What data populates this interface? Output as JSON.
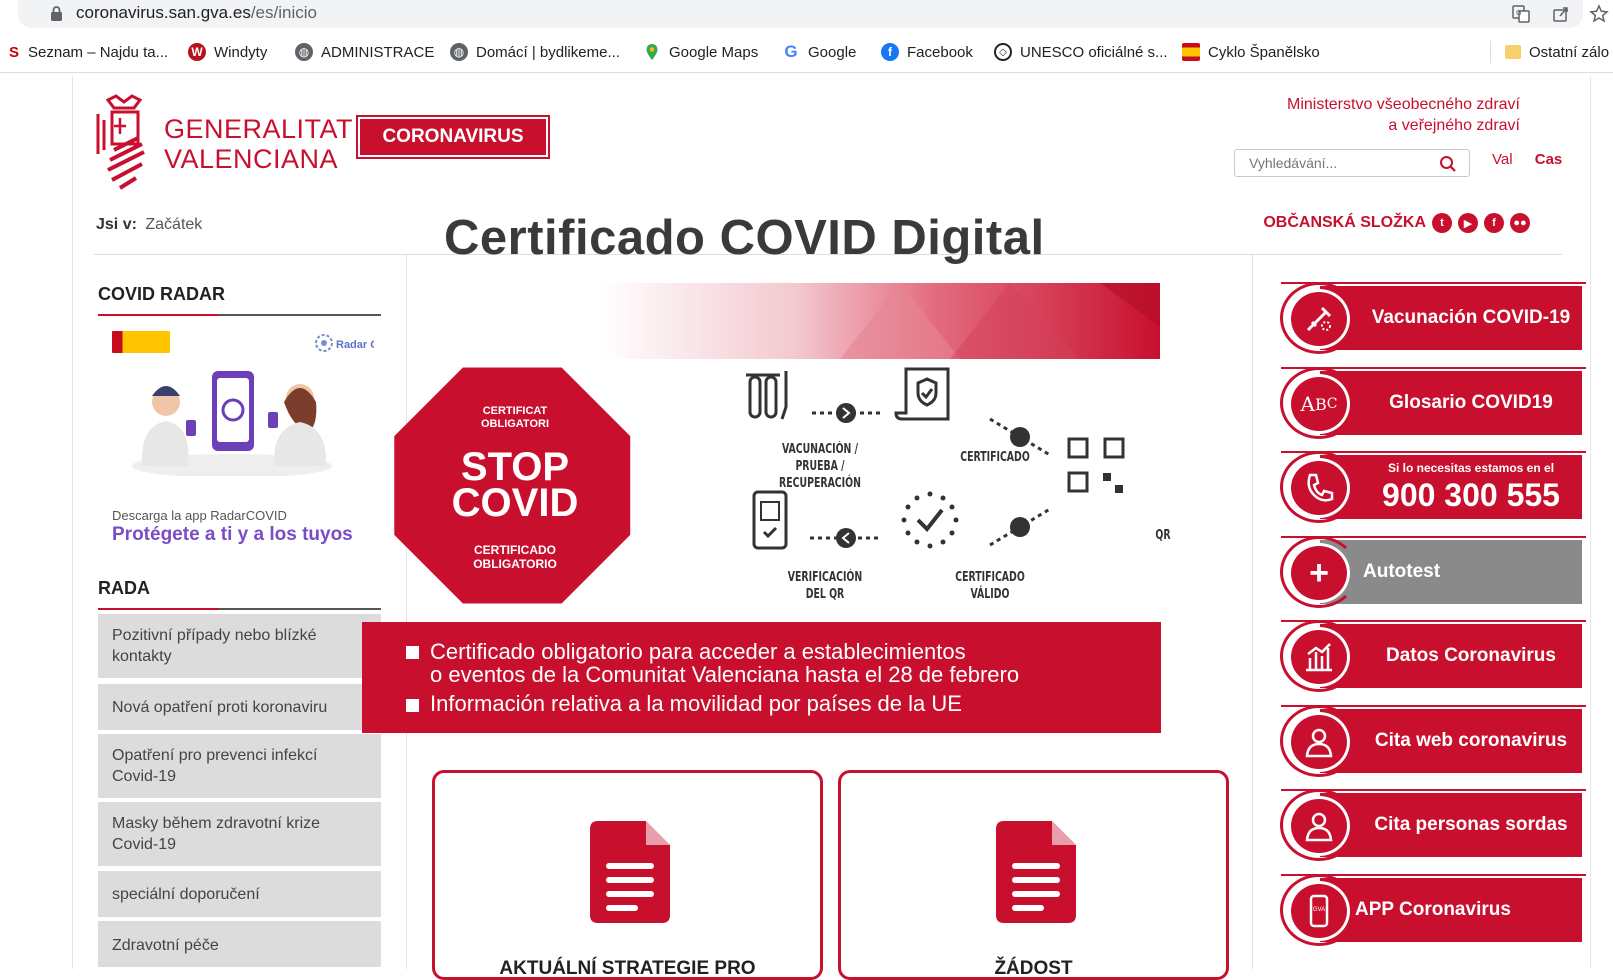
{
  "browser": {
    "url_host": "coronavirus.san.gva.es",
    "url_path": "/es/inicio",
    "bookmarks": [
      {
        "label": "Seznam – Najdu ta...",
        "icon": "seznam-icon"
      },
      {
        "label": "Windyty",
        "icon": "windyty-icon"
      },
      {
        "label": "ADMINISTRACE",
        "icon": "globe-icon"
      },
      {
        "label": "Domácí | bydlikeme...",
        "icon": "globe-icon"
      },
      {
        "label": "Google Maps",
        "icon": "maps-pin-icon"
      },
      {
        "label": "Google",
        "icon": "google-icon"
      },
      {
        "label": "Facebook",
        "icon": "facebook-icon"
      },
      {
        "label": "UNESCO oficiálné s...",
        "icon": "unesco-icon"
      },
      {
        "label": "Cyklo Španělsko",
        "icon": "spain-flag-icon"
      }
    ],
    "other_bookmarks": "Ostatní zálo"
  },
  "header": {
    "logo_line1": "GENERALITAT",
    "logo_line2": "VALENCIANA",
    "badge": "CORONAVIRUS",
    "ministry_line1": "Ministerstvo všeobecného zdraví",
    "ministry_line2": "a veřejného zdraví",
    "search_placeholder": "Vyhledávání...",
    "lang_val": "Val",
    "lang_cas": "Cas",
    "breadcrumb_label": "Jsi v:",
    "breadcrumb_current": "Začátek",
    "citizen_folder": "OBČANSKÁ SLOŽKA"
  },
  "left": {
    "radar_title": "COVID RADAR",
    "radar_logo": "Radar COVID",
    "radar_download": "Descarga la app RadarCOVID",
    "radar_protect": "Protégete a ti y a los tuyos",
    "advice_title": "RADA",
    "menu": [
      "Pozitivní případy nebo blízké kontakty",
      "Nová opatření proti koronaviru",
      "Opatření pro prevenci infekcí Covid-19",
      "Masky během zdravotní krize Covid-19",
      "speciální doporučení",
      "Zdravotní péče"
    ]
  },
  "hero": {
    "title_a": "Certificado",
    "title_b": "COVID Digital",
    "stop_small": "CERTIFICAT OBLIGATORI",
    "stop_big1": "STOP",
    "stop_big2": "COVID",
    "stop_bottom1": "CERTIFICADO",
    "stop_bottom2": "OBLIGATORIO",
    "step_vacuna": "VACUNACIÓN / PRUEBA / RECUPERACIÓN",
    "step_cert": "CERTIFICADO",
    "step_qr": "QR",
    "step_verif": "VERIFICACIÓN DEL QR",
    "step_valid": "CERTIFICADO VÁLIDO",
    "banner_l1": "Certificado obligatorio para acceder a establecimientos",
    "banner_l2": "o eventos de la Comunitat Valenciana hasta el 28 de febrero",
    "banner_l3": "Información relativa a la movilidad por países de la UE"
  },
  "cards": [
    {
      "title": "AKTUÁLNÍ STRATEGIE PRO"
    },
    {
      "title": "ŽÁDOST"
    }
  ],
  "right": {
    "buttons": [
      {
        "label": "Vacunación COVID-19",
        "icon": "vaccine-icon"
      },
      {
        "label": "Glosario COVID19",
        "icon": "abc-icon"
      },
      {
        "label_small": "Si lo necesitas estamos en el",
        "label": "900 300 555",
        "icon": "phone-icon"
      },
      {
        "label": "Autotest",
        "icon": "plus-icon"
      },
      {
        "label": "Datos Coronavirus",
        "icon": "chart-icon"
      },
      {
        "label": "Cita web coronavirus",
        "icon": "person-icon"
      },
      {
        "label": "Cita personas sordas",
        "icon": "person-icon"
      },
      {
        "label": "APP Coronavirus",
        "icon": "phone-app-icon",
        "icon_text": "GVA"
      }
    ]
  },
  "colors": {
    "brand_red": "#c8102e",
    "radar_purple": "#7a4cc8",
    "grey_button": "#8a8a8a"
  }
}
